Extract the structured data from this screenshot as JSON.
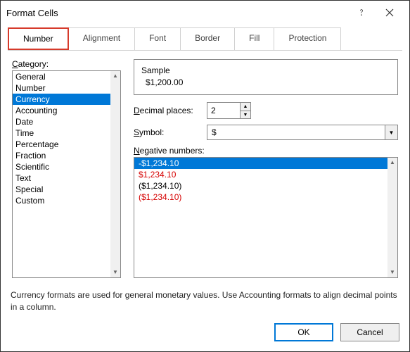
{
  "title": "Format Cells",
  "tabs": [
    {
      "label": "Number",
      "active": true
    },
    {
      "label": "Alignment",
      "active": false
    },
    {
      "label": "Font",
      "active": false
    },
    {
      "label": "Border",
      "active": false
    },
    {
      "label": "Fill",
      "active": false
    },
    {
      "label": "Protection",
      "active": false
    }
  ],
  "category_label": "Category:",
  "category_underline": "C",
  "categories": [
    {
      "label": "General",
      "selected": false
    },
    {
      "label": "Number",
      "selected": false
    },
    {
      "label": "Currency",
      "selected": true
    },
    {
      "label": "Accounting",
      "selected": false
    },
    {
      "label": "Date",
      "selected": false
    },
    {
      "label": "Time",
      "selected": false
    },
    {
      "label": "Percentage",
      "selected": false
    },
    {
      "label": "Fraction",
      "selected": false
    },
    {
      "label": "Scientific",
      "selected": false
    },
    {
      "label": "Text",
      "selected": false
    },
    {
      "label": "Special",
      "selected": false
    },
    {
      "label": "Custom",
      "selected": false
    }
  ],
  "sample_label": "Sample",
  "sample_value": "$1,200.00",
  "decimal_label": "Decimal places:",
  "decimal_underline": "D",
  "decimal_value": "2",
  "symbol_label": "Symbol:",
  "symbol_underline": "S",
  "symbol_value": "$",
  "negative_label": "Negative numbers:",
  "negative_underline": "N",
  "negative_options": [
    {
      "text": "-$1,234.10",
      "color": "#000000",
      "selected": true
    },
    {
      "text": "$1,234.10",
      "color": "#d60000",
      "selected": false
    },
    {
      "text": "($1,234.10)",
      "color": "#000000",
      "selected": false
    },
    {
      "text": "($1,234.10)",
      "color": "#d60000",
      "selected": false
    }
  ],
  "description": "Currency formats are used for general monetary values.  Use Accounting formats to align decimal points in a column.",
  "buttons": {
    "ok": "OK",
    "cancel": "Cancel"
  }
}
